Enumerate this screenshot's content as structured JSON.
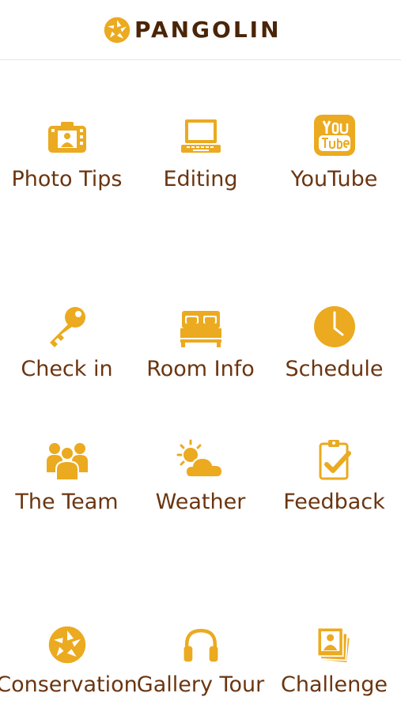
{
  "app": {
    "logo_text": "PANGOLIN",
    "accent": "#ebaa1f",
    "text_color": "#6b3510"
  },
  "grid": {
    "rows": [
      [
        {
          "label": "Photo Tips",
          "icon": "photo-tips-icon"
        },
        {
          "label": "Editing",
          "icon": "laptop-icon"
        },
        {
          "label": "YouTube",
          "icon": "youtube-icon"
        }
      ],
      [
        {
          "label": "Check in",
          "icon": "key-icon"
        },
        {
          "label": "Room Info",
          "icon": "bed-icon"
        },
        {
          "label": "Schedule",
          "icon": "clock-icon"
        }
      ],
      [
        {
          "label": "The Team",
          "icon": "team-icon"
        },
        {
          "label": "Weather",
          "icon": "weather-icon"
        },
        {
          "label": "Feedback",
          "icon": "clipboard-check-icon"
        }
      ],
      [
        {
          "label": "Conservation",
          "icon": "aperture-icon"
        },
        {
          "label": "Gallery Tour",
          "icon": "headphones-icon"
        },
        {
          "label": "Challenge",
          "icon": "photos-stack-icon"
        }
      ]
    ]
  }
}
